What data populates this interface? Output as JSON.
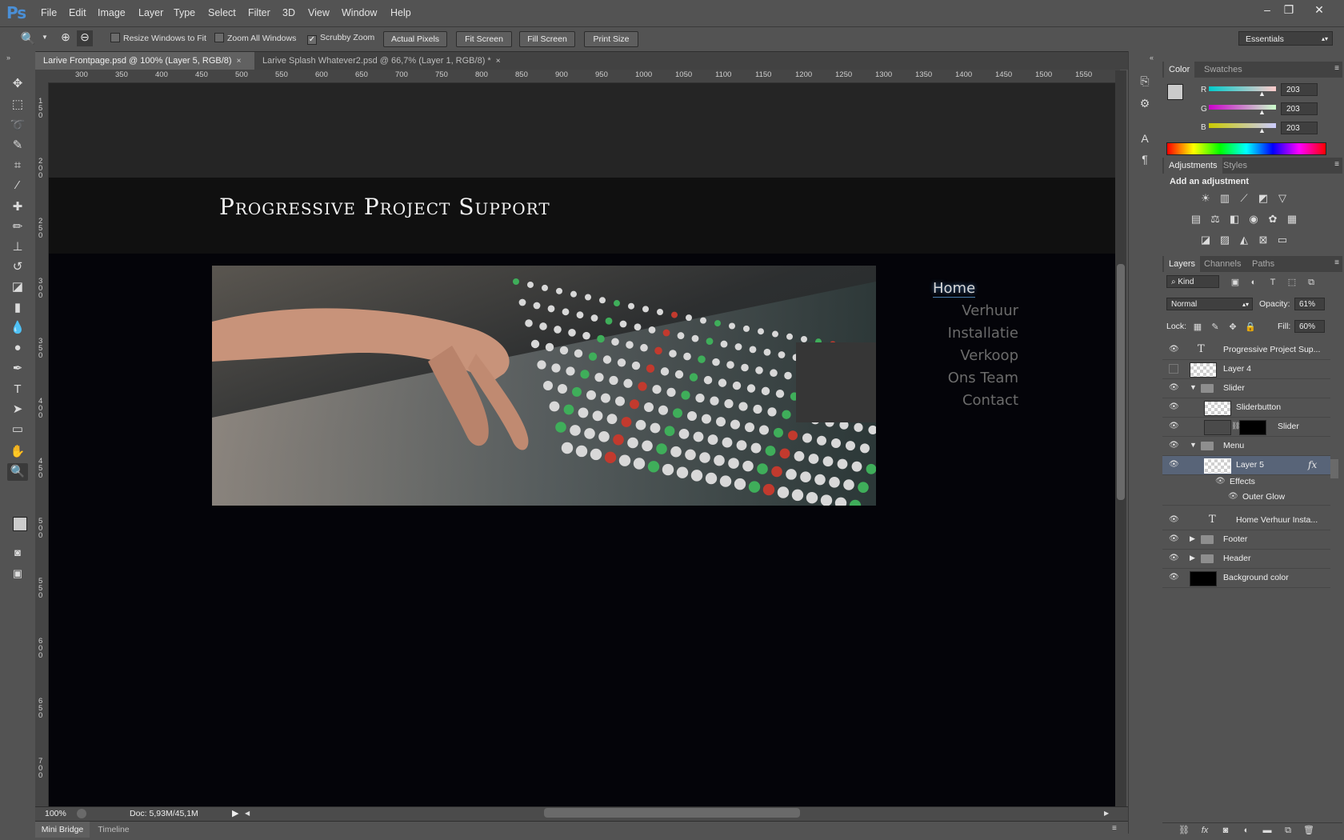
{
  "app": {
    "logo": "Ps",
    "menu": [
      "File",
      "Edit",
      "Image",
      "Layer",
      "Type",
      "Select",
      "Filter",
      "3D",
      "View",
      "Window",
      "Help"
    ],
    "window_controls": [
      "–",
      "❐",
      "✕"
    ]
  },
  "options_bar": {
    "resize_windows": "Resize Windows to Fit",
    "zoom_all": "Zoom All Windows",
    "scrubby_zoom": "Scrubby Zoom",
    "actual_pixels": "Actual Pixels",
    "fit_screen": "Fit Screen",
    "fill_screen": "Fill Screen",
    "print_size": "Print Size",
    "workspace": "Essentials"
  },
  "tabs": [
    {
      "title": "Larive Frontpage.psd @ 100% (Layer 5, RGB/8)",
      "close": "×"
    },
    {
      "title": "Larive Splash Whatever2.psd @ 66,7% (Layer 1, RGB/8) *",
      "close": "×"
    }
  ],
  "ruler_h": [
    "300",
    "350",
    "400",
    "450",
    "500",
    "550",
    "600",
    "650",
    "700",
    "750",
    "800",
    "850",
    "900",
    "950",
    "1000",
    "1050",
    "1100",
    "1150",
    "1200",
    "1250",
    "1300",
    "1350",
    "1400",
    "1450",
    "1500",
    "1550"
  ],
  "ruler_v": [
    "1",
    "5",
    "0",
    "2",
    "0",
    "0",
    "2",
    "5",
    "0",
    "3",
    "0",
    "0",
    "3",
    "5",
    "0",
    "4",
    "0",
    "0",
    "4",
    "5",
    "0",
    "5",
    "0",
    "0",
    "5",
    "5",
    "0",
    "6",
    "0",
    "0",
    "6",
    "5",
    "0",
    "7",
    "0",
    "0"
  ],
  "canvas": {
    "site_title": "Progressive Project Support",
    "nav": [
      "Home",
      "Verhuur",
      "Installatie",
      "Verkoop",
      "Ons Team",
      "Contact"
    ]
  },
  "status": {
    "zoom": "100%",
    "doc": "Doc: 5,93M/45,1M"
  },
  "bottom_tabs": [
    "Mini Bridge",
    "Timeline"
  ],
  "color_panel": {
    "tabs": [
      "Color",
      "Swatches"
    ],
    "r_label": "R",
    "g_label": "G",
    "b_label": "B",
    "r": "203",
    "g": "203",
    "b": "203",
    "colors": {
      "fg": "#cbcbcb",
      "bg": "#ffffff"
    }
  },
  "adjustments_panel": {
    "tabs": [
      "Adjustments",
      "Styles"
    ],
    "heading": "Add an adjustment"
  },
  "layers_panel": {
    "tabs": [
      "Layers",
      "Channels",
      "Paths"
    ],
    "filter": "Kind",
    "blend_mode": "Normal",
    "opacity_label": "Opacity:",
    "opacity": "61%",
    "lock_label": "Lock:",
    "fill_label": "Fill:",
    "fill": "60%",
    "layers": [
      {
        "name": "Progressive Project Sup...",
        "kind": "text"
      },
      {
        "name": "Layer 4",
        "kind": "pixel"
      },
      {
        "name": "Slider",
        "kind": "group"
      },
      {
        "name": "Sliderbutton",
        "kind": "pixel"
      },
      {
        "name": "Slider",
        "kind": "masked"
      },
      {
        "name": "Menu",
        "kind": "group"
      },
      {
        "name": "Layer 5",
        "kind": "pixel"
      },
      {
        "name": "Effects",
        "kind": "effects"
      },
      {
        "name": "Outer Glow",
        "kind": "effect"
      },
      {
        "name": "Home Verhuur Insta...",
        "kind": "text"
      },
      {
        "name": "Footer",
        "kind": "group"
      },
      {
        "name": "Header",
        "kind": "group"
      },
      {
        "name": "Background color",
        "kind": "fill"
      }
    ],
    "fx": "fx"
  }
}
